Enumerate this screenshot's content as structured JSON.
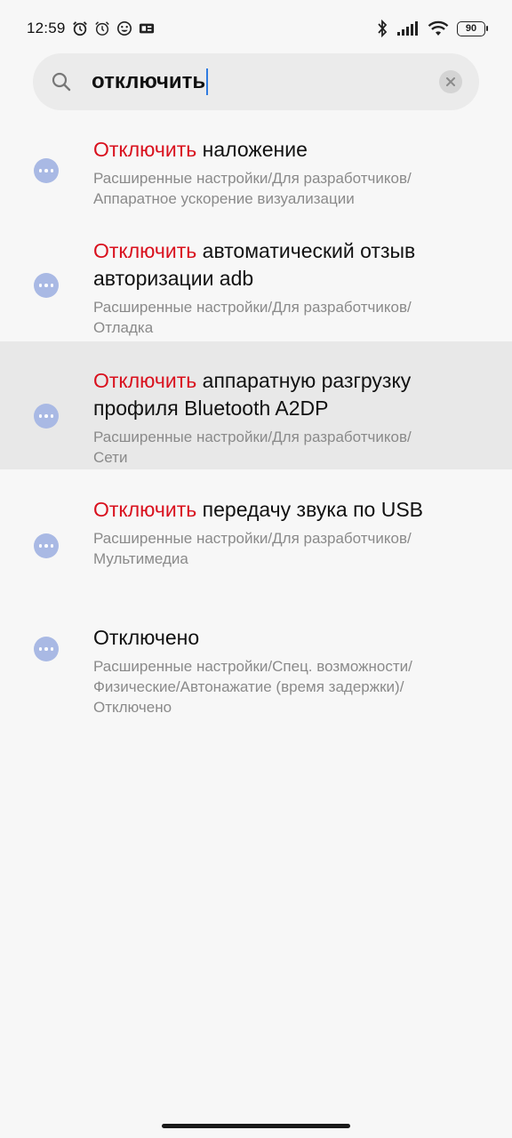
{
  "status_bar": {
    "time": "12:59",
    "battery": "90"
  },
  "search": {
    "query": "отключить"
  },
  "results": [
    {
      "title_highlight": "Отключить",
      "title_rest": " наложение",
      "path_line1": "Расширенные настройки/Для разработчиков/",
      "path_line2": "Аппаратное ускорение визуализации"
    },
    {
      "title_highlight": "Отключить",
      "title_rest": " автоматический отзыв авторизации adb",
      "path_line1": "Расширенные настройки/Для разработчиков/",
      "path_line2": "Отладка"
    },
    {
      "title_highlight": "Отключить",
      "title_rest": " аппаратную разгрузку профиля Bluetooth A2DP",
      "path_line1": "Расширенные настройки/Для разработчиков/",
      "path_line2": "Сети"
    },
    {
      "title_highlight": "Отключить",
      "title_rest": " передачу звука по USB",
      "path_line1": "Расширенные настройки/Для разработчиков/",
      "path_line2": "Мультимедиа"
    },
    {
      "title_highlight": "",
      "title_rest": "Отключено",
      "path_line1": "Расширенные настройки/Спец. возможности/",
      "path_line2": "Физические/Автонажатие (время задержки)/",
      "path_line3": "Отключено"
    }
  ],
  "colors": {
    "highlight": "#d9111e",
    "item_icon": "#a9b9e4",
    "cursor": "#2f7be0"
  }
}
